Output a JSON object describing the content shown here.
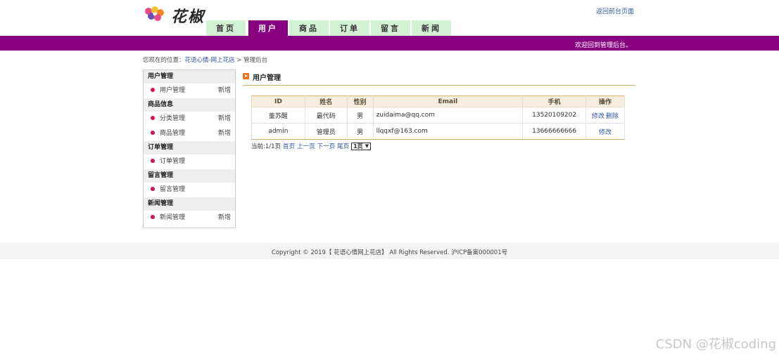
{
  "header": {
    "logo_text": "花椒",
    "return_link": "返回前台页面",
    "nav_tabs": [
      "首页",
      "用户",
      "商品",
      "订单",
      "留言",
      "新闻"
    ],
    "active_tab": "用户",
    "welcome": "欢迎回到管理后台。"
  },
  "breadcrumb": {
    "prefix": "您现在的位置：",
    "link": "花语心情-网上花店",
    "separator": " > ",
    "current": "管理后台"
  },
  "sidebar": {
    "sections": [
      {
        "title": "用户管理",
        "items": [
          {
            "label": "用户管理",
            "add": "新增"
          }
        ]
      },
      {
        "title": "商品信息",
        "items": [
          {
            "label": "分类管理",
            "add": "新增"
          },
          {
            "label": "商品管理",
            "add": "新增"
          }
        ]
      },
      {
        "title": "订单管理",
        "items": [
          {
            "label": "订单管理",
            "add": ""
          }
        ]
      },
      {
        "title": "留言管理",
        "items": [
          {
            "label": "留言管理",
            "add": ""
          }
        ]
      },
      {
        "title": "新闻管理",
        "items": [
          {
            "label": "新闻管理",
            "add": "新增"
          }
        ]
      }
    ]
  },
  "main": {
    "title": "用户管理",
    "table": {
      "headers": [
        "ID",
        "姓名",
        "性别",
        "Email",
        "手机",
        "操作"
      ],
      "rows": [
        {
          "id": "董苏醒",
          "name": "最代码",
          "gender": "男",
          "email": "zuidaima@qq.com",
          "phone": "13520109202",
          "ops": [
            "修改",
            "删除"
          ]
        },
        {
          "id": "admin",
          "name": "管理员",
          "gender": "男",
          "email": "llqqxf@163.com",
          "phone": "13666666666",
          "ops": [
            "修改"
          ]
        }
      ]
    },
    "pager": {
      "current": "当前:1/1页",
      "first": "首页",
      "prev": "上一页",
      "next": "下一页",
      "last": "尾页",
      "select_value": "1页"
    }
  },
  "footer": {
    "copyright": "Copyright © 2019【 花语心情网上花店】 All Rights Reserved. 沪ICP备案000001号"
  },
  "watermark": "CSDN @花椒coding",
  "colors": {
    "brand": "#880080",
    "tab": "#d3f1d3",
    "link": "#2e56a0",
    "accent": "#d9b26a"
  }
}
